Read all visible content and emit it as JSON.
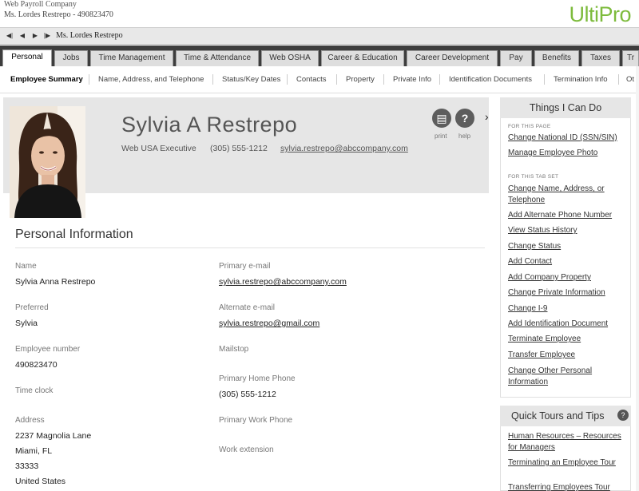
{
  "header": {
    "company": "Web Payroll Company",
    "user_line": "Ms. Lordes Restrepo - 490823470",
    "logo": "UltiPro"
  },
  "record_nav": {
    "name": "Ms. Lordes Restrepo",
    "buttons": [
      "first-record-icon",
      "previous-record-icon",
      "next-record-icon",
      "last-record-icon"
    ]
  },
  "tabs": [
    "Personal",
    "Jobs",
    "Time Management",
    "Time & Attendance",
    "Web OSHA",
    "Career & Education",
    "Career Development",
    "Pay",
    "Benefits",
    "Taxes",
    "Tr"
  ],
  "subnav": [
    "Employee Summary",
    "Name, Address, and Telephone",
    "Status/Key Dates",
    "Contacts",
    "Property",
    "Private Info",
    "Identification Documents",
    "Termination Info",
    "Ot"
  ],
  "profile": {
    "name": "Sylvia A Restrepo",
    "title": "Web USA Executive",
    "phone": "(305) 555-1212",
    "email": "sylvia.restrepo@abccompany.com",
    "print_label": "print",
    "help_label": "help"
  },
  "personal_info": {
    "title": "Personal Information",
    "left": [
      {
        "label": "Name",
        "value": "Sylvia Anna Restrepo"
      },
      {
        "label": "Preferred",
        "value": "Sylvia"
      },
      {
        "label": "Employee number",
        "value": "490823470"
      },
      {
        "label": "Time clock",
        "value": ""
      },
      {
        "label": "Address",
        "lines": [
          "2237 Magnolia Lane",
          "Miami, FL",
          "33333",
          "United States"
        ]
      }
    ],
    "right": [
      {
        "label": "Primary e-mail",
        "value": "sylvia.restrepo@abccompany.com"
      },
      {
        "label": "Alternate e-mail",
        "value": "sylvia.restrepo@gmail.com"
      },
      {
        "label": "Mailstop",
        "value": ""
      },
      {
        "label": "Primary Home Phone",
        "value": "(305) 555-1212"
      },
      {
        "label": "Primary Work Phone",
        "value": ""
      },
      {
        "label": "Work extension",
        "value": ""
      }
    ]
  },
  "things_i_can_do": {
    "title": "Things I Can Do",
    "page_caption": "FOR THIS PAGE",
    "page_links": [
      "Change National ID (SSN/SIN)",
      "Manage Employee Photo"
    ],
    "tab_caption": "FOR THIS TAB SET",
    "tab_links": [
      "Change Name, Address, or Telephone",
      "Add Alternate Phone Number",
      "View Status History",
      "Change Status",
      "Add Contact",
      "Add Company Property",
      "Change Private Information",
      "Change I-9",
      "Add Identification Document",
      "Terminate Employee",
      "Transfer Employee",
      "Change Other Personal Information"
    ]
  },
  "quick_tours": {
    "title": "Quick Tours and Tips",
    "links": [
      "Human Resources – Resources for Managers",
      "Terminating an Employee Tour",
      "Transferring Employees Tour"
    ]
  },
  "colors": {
    "logo_green": "#7dbb3c",
    "tab_bar": "#3d3d3d",
    "banner": "#e6e6e6"
  }
}
